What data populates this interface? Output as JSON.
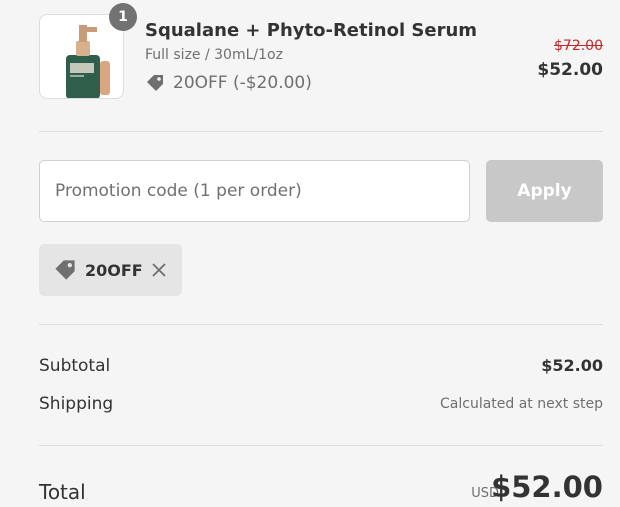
{
  "product": {
    "quantity": "1",
    "name": "Squalane + Phyto-Retinol Serum",
    "variant": "Full size / 30mL/1oz",
    "discount_text": "20OFF (-$20.00)",
    "original_price": "$72.00",
    "price": "$52.00"
  },
  "promo": {
    "placeholder": "Promotion code (1 per order)",
    "apply_label": "Apply",
    "applied_code": "20OFF"
  },
  "summary": {
    "subtotal_label": "Subtotal",
    "subtotal_value": "$52.00",
    "shipping_label": "Shipping",
    "shipping_value": "Calculated at next step",
    "total_label": "Total",
    "currency": "USD",
    "total_value": "$52.00"
  },
  "colors": {
    "strike_price": "#c62828",
    "apply_disabled": "#c8c8c8",
    "bottle": "#2f5e4a"
  }
}
